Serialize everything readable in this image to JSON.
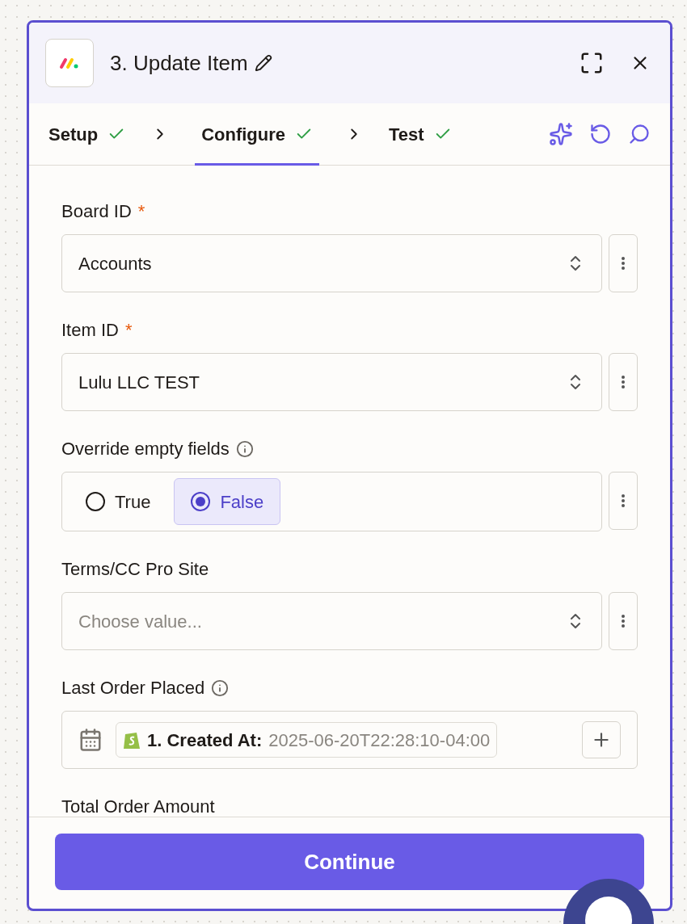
{
  "header": {
    "title": "3. Update Item"
  },
  "steps": [
    {
      "label": "Setup",
      "done": true,
      "selected": false
    },
    {
      "label": "Configure",
      "done": true,
      "selected": true
    },
    {
      "label": "Test",
      "done": true,
      "selected": false
    }
  ],
  "fields": [
    {
      "kind": "select",
      "label": "Board ID",
      "required_mark": "*",
      "value": "Accounts"
    },
    {
      "kind": "select",
      "label": "Item ID",
      "required_mark": "*",
      "value": "Lulu LLC TEST"
    },
    {
      "kind": "radio",
      "label": "Override empty fields",
      "info": true,
      "options": [
        {
          "label": "True",
          "selected": false
        },
        {
          "label": "False",
          "selected": true
        }
      ]
    },
    {
      "kind": "select",
      "label": "Terms/CC Pro Site",
      "placeholder": "Choose value..."
    },
    {
      "kind": "datetime",
      "label": "Last Order Placed",
      "info": true,
      "token": {
        "name": "1. Created At:",
        "value": "2025-06-20T22:28:10-04:00"
      }
    },
    {
      "kind": "label",
      "label": "Total Order Amount"
    }
  ],
  "footer": {
    "button": "Continue"
  }
}
